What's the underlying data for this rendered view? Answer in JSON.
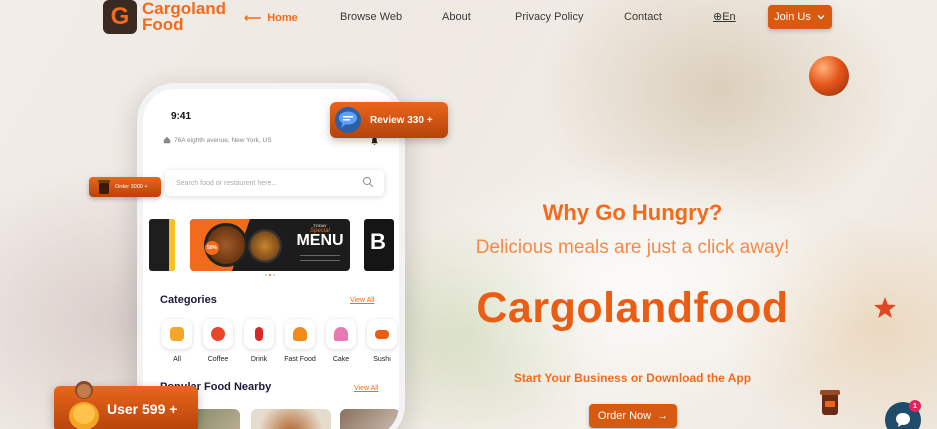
{
  "brand": {
    "logo_letter": "G",
    "name_line1": "Cargoland",
    "name_line2": "Food",
    "accent_color": "#f26b1d"
  },
  "nav": {
    "links": [
      {
        "label": "Home",
        "active": true,
        "icon": "arrow-left-icon"
      },
      {
        "label": "Browse Web"
      },
      {
        "label": "About"
      },
      {
        "label": "Privacy Policy"
      },
      {
        "label": "Contact"
      }
    ],
    "language": "En",
    "language_icon": "globe-icon",
    "join_label": "Join Us",
    "join_icon": "chevron-down-icon"
  },
  "phone": {
    "time": "9:41",
    "address": "76A eighth avenue, New York, US",
    "search_placeholder": "Search food or restaurent here...",
    "banner": {
      "badge": "50%",
      "tag": "TODAY",
      "script": "Special",
      "title": "MENU",
      "side_letter": "B"
    },
    "categories_title": "Categories",
    "categories_view_all": "View All",
    "categories": [
      {
        "label": "All",
        "icon": "all-food-icon",
        "color": "#f4a62a"
      },
      {
        "label": "Coffee",
        "icon": "coffee-icon",
        "color": "#e8462a"
      },
      {
        "label": "Drink",
        "icon": "drink-icon",
        "color": "#d62a2a"
      },
      {
        "label": "Fast Food",
        "icon": "burger-icon",
        "color": "#f28b1d"
      },
      {
        "label": "Cake",
        "icon": "cupcake-icon",
        "color": "#e87ab0"
      },
      {
        "label": "Sushi",
        "icon": "sushi-icon",
        "color": "#e95e14"
      }
    ],
    "popular_title": "Popular Food Nearby",
    "popular_view_all": "View All"
  },
  "badges": {
    "review": "Review 330 +",
    "order": "Order 3000 +",
    "users": "User 599 +"
  },
  "hero": {
    "kicker": "Why Go Hungry?",
    "tagline": "Delicious meals are just a click away!",
    "brand_title": "Cargolandfood",
    "subtitle": "Start Your Business or Download the App",
    "cta_label": "Order Now",
    "cta_icon": "arrow-right-icon"
  },
  "chat_widget": {
    "unread": "1",
    "icon": "chat-bubble-icon"
  }
}
